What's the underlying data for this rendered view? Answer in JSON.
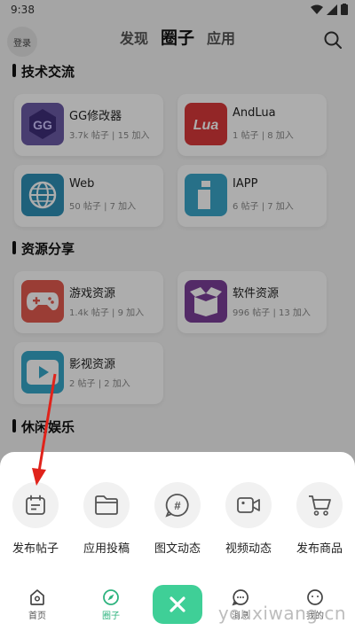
{
  "status": {
    "time": "9:38"
  },
  "header": {
    "login_label": "登录",
    "tabs": [
      {
        "label": "发现"
      },
      {
        "label": "圈子",
        "active": true
      },
      {
        "label": "应用"
      }
    ]
  },
  "sections": [
    {
      "title": "技术交流",
      "cards": [
        {
          "name": "GG修改器",
          "meta": "3.7k 帖子 | 15 加入",
          "icon": "gg-icon",
          "color": "#6b5aa6"
        },
        {
          "name": "AndLua",
          "meta": "1 帖子 | 8 加入",
          "icon": "lua-icon",
          "color": "#d9393a"
        },
        {
          "name": "Web",
          "meta": "50 帖子 | 7 加入",
          "icon": "globe-icon",
          "color": "#2f8fb5"
        },
        {
          "name": "IAPP",
          "meta": "6 帖子 | 7 加入",
          "icon": "iapp-icon",
          "color": "#3aa6c9"
        }
      ]
    },
    {
      "title": "资源分享",
      "cards": [
        {
          "name": "游戏资源",
          "meta": "1.4k 帖子 | 9 加入",
          "icon": "gamepad-icon",
          "color": "#e35b4f"
        },
        {
          "name": "软件资源",
          "meta": "996 帖子 | 13 加入",
          "icon": "box-icon",
          "color": "#7b3f98"
        },
        {
          "name": "影视资源",
          "meta": "2 帖子 | 2 加入",
          "icon": "play-icon",
          "color": "#36a7c9"
        }
      ]
    },
    {
      "title": "休闲娱乐",
      "cards": []
    }
  ],
  "sheet": {
    "actions": [
      {
        "label": "发布帖子",
        "icon": "calendar-icon"
      },
      {
        "label": "应用投稿",
        "icon": "folder-icon"
      },
      {
        "label": "图文动态",
        "icon": "hashtag-icon"
      },
      {
        "label": "视频动态",
        "icon": "video-icon"
      },
      {
        "label": "发布商品",
        "icon": "cart-icon"
      }
    ]
  },
  "bottom_nav": [
    {
      "label": "首页",
      "icon": "home-icon"
    },
    {
      "label": "圈子",
      "icon": "compass-icon",
      "active": true
    },
    {
      "label": "消息",
      "icon": "chat-icon"
    },
    {
      "label": "我的",
      "icon": "face-icon"
    }
  ],
  "watermark": "youxiwang.cn",
  "colors": {
    "accent": "#3fcf97",
    "active_tab": "#2db37e"
  }
}
